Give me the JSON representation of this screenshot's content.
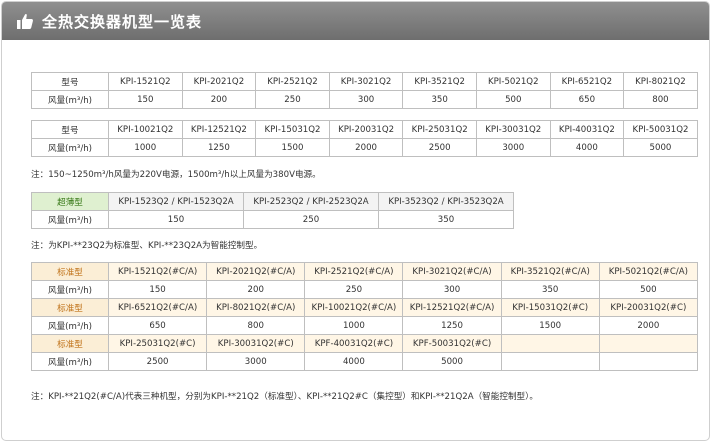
{
  "header": {
    "title": "全热交换器机型一览表",
    "icon": "thumbs-up-icon"
  },
  "table1": {
    "label_model": "型号",
    "label_air": "风量(m³/h)",
    "models": [
      "KPI-1521Q2",
      "KPI-2021Q2",
      "KPI-2521Q2",
      "KPI-3021Q2",
      "KPI-3521Q2",
      "KPI-5021Q2",
      "KPI-6521Q2",
      "KPI-8021Q2"
    ],
    "air": [
      "150",
      "200",
      "250",
      "300",
      "350",
      "500",
      "650",
      "800"
    ]
  },
  "table2": {
    "label_model": "型号",
    "label_air": "风量(m³/h)",
    "models": [
      "KPI-10021Q2",
      "KPI-12521Q2",
      "KPI-15031Q2",
      "KPI-20031Q2",
      "KPI-25031Q2",
      "KPI-30031Q2",
      "KPI-40031Q2",
      "KPI-50031Q2"
    ],
    "air": [
      "1000",
      "1250",
      "1500",
      "2000",
      "2500",
      "3000",
      "4000",
      "5000"
    ]
  },
  "note1": "注：150~1250m³/h风量为220V电源，1500m³/h以上风量为380V电源。",
  "table3": {
    "label_model": "超薄型",
    "label_air": "风量(m³/h)",
    "models": [
      "KPI-1523Q2 / KPI-1523Q2A",
      "KPI-2523Q2 / KPI-2523Q2A",
      "KPI-3523Q2 / KPI-3523Q2A"
    ],
    "air": [
      "150",
      "250",
      "350"
    ]
  },
  "note2": "注：为KPI-**23Q2为标准型、KPI-**23Q2A为智能控制型。",
  "table4": {
    "rows": [
      {
        "label_model": "标准型",
        "label_air": "风量(m³/h)",
        "models": [
          "KPI-1521Q2(#C/A)",
          "KPI-2021Q2(#C/A)",
          "KPI-2521Q2(#C/A)",
          "KPI-3021Q2(#C/A)",
          "KPI-3521Q2(#C/A)",
          "KPI-5021Q2(#C/A)"
        ],
        "air": [
          "150",
          "200",
          "250",
          "300",
          "350",
          "500"
        ]
      },
      {
        "label_model": "标准型",
        "label_air": "风量(m³/h)",
        "models": [
          "KPI-6521Q2(#C/A)",
          "KPI-8021Q2(#C/A)",
          "KPI-10021Q2(#C/A)",
          "KPI-12521Q2(#C/A)",
          "KPI-15031Q2(#C)",
          "KPI-20031Q2(#C)"
        ],
        "air": [
          "650",
          "800",
          "1000",
          "1250",
          "1500",
          "2000"
        ]
      },
      {
        "label_model": "标准型",
        "label_air": "风量(m³/h)",
        "models": [
          "KPI-25031Q2(#C)",
          "KPI-30031Q2(#C)",
          "KPF-40031Q2(#C)",
          "KPF-50031Q2(#C)",
          "",
          ""
        ],
        "air": [
          "2500",
          "3000",
          "4000",
          "5000",
          "",
          ""
        ]
      }
    ]
  },
  "note3": "注：KPI-**21Q2(#C/A)代表三种机型，分别为KPI-**21Q2（标准型）、KPI-**21Q2#C（集控型）和KPI-**21Q2A（智能控制型）。"
}
